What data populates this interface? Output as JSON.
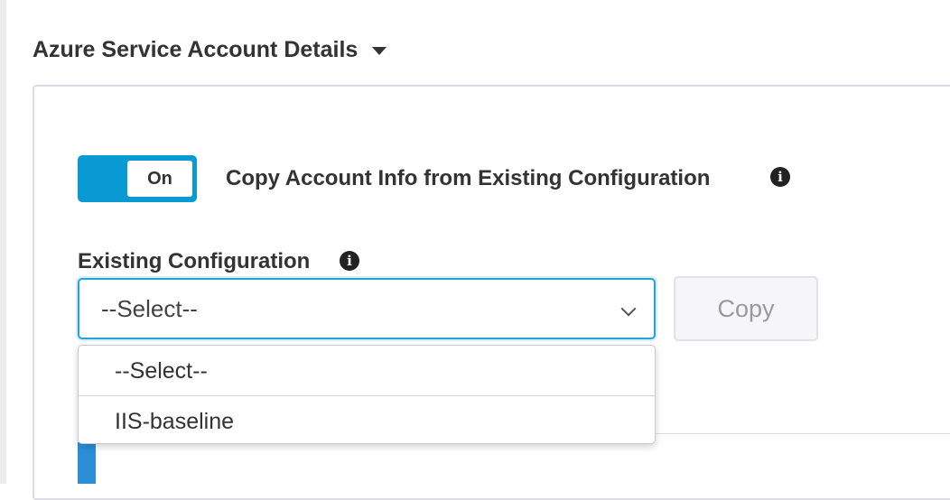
{
  "section": {
    "title": "Azure Service Account Details",
    "caret_icon": "caret-down-icon"
  },
  "copy_toggle": {
    "state": "On",
    "caption": "Copy Account Info from Existing Configuration",
    "info_icon": "info-icon",
    "accent_color": "#0a9ad3"
  },
  "existing_configuration": {
    "label": "Existing Configuration",
    "info_icon": "info-icon",
    "selected_value": "--Select--",
    "options": [
      "--Select--",
      "IIS-baseline"
    ]
  },
  "copy_button": {
    "label": "Copy"
  }
}
